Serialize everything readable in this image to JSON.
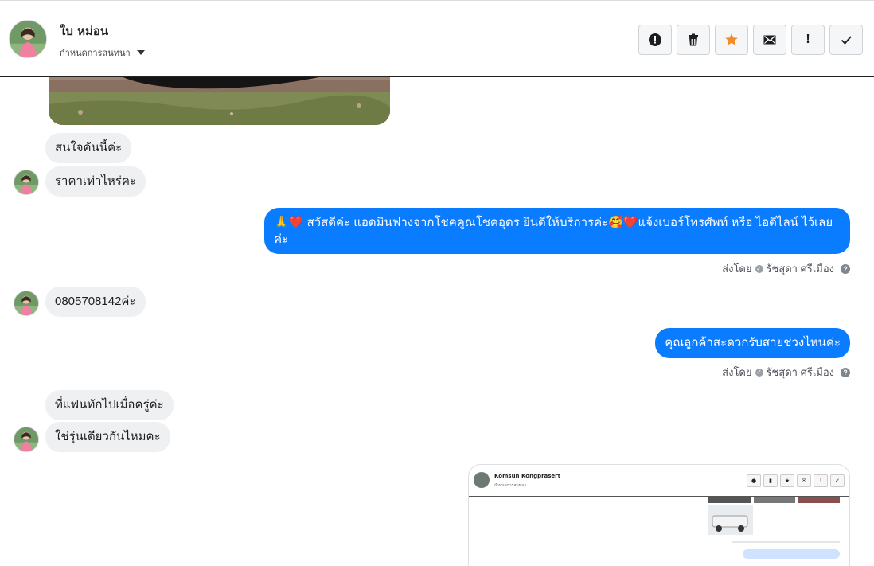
{
  "header": {
    "contact_name": "ใบ หม่อน",
    "conversation_label": "กำหนดการสนทนา",
    "actions": [
      {
        "name": "mark-spam-button",
        "icon": "alert-circle-icon"
      },
      {
        "name": "delete-button",
        "icon": "trash-icon"
      },
      {
        "name": "star-button",
        "icon": "star-icon"
      },
      {
        "name": "mark-unread-button",
        "icon": "envelope-icon"
      },
      {
        "name": "follow-up-button",
        "icon": "exclamation-icon"
      },
      {
        "name": "mark-done-button",
        "icon": "check-icon"
      }
    ]
  },
  "messages": {
    "m1": "สนใจคันนี้ค่ะ",
    "m2": "ราคาเท่าไหร่คะ",
    "m3": "🙏❤️ สวัสดีค่ะ แอดมินฟางจากโชคคูณโชคอุดร ยินดีให้บริการค่ะ🥰❤️แจ้งเบอร์โทรศัพท์ หรือ ไอดีไลน์  ไว้เลยค่ะ",
    "m4": "0805708142ค่ะ",
    "m5": "คุณลูกค้าสะดวกรับสายช่วงไหนค่ะ",
    "m6": "ที่แฟนทักไปเมื่อครู่ค่ะ",
    "m7": "ใช่รุ่นเดียวกันไหมคะ"
  },
  "sent_by": {
    "prefix": "ส่งโดย",
    "agent": "รัชสุดา ศรีเมือง",
    "help_glyph": "?"
  },
  "attachment": {
    "name": "Komsun Kongprasert",
    "sub": "กำหนดการสนทนา"
  },
  "colors": {
    "outgoing_bubble": "#0a7cff",
    "incoming_bubble": "#eff0f2",
    "star_active": "#f28c28"
  }
}
